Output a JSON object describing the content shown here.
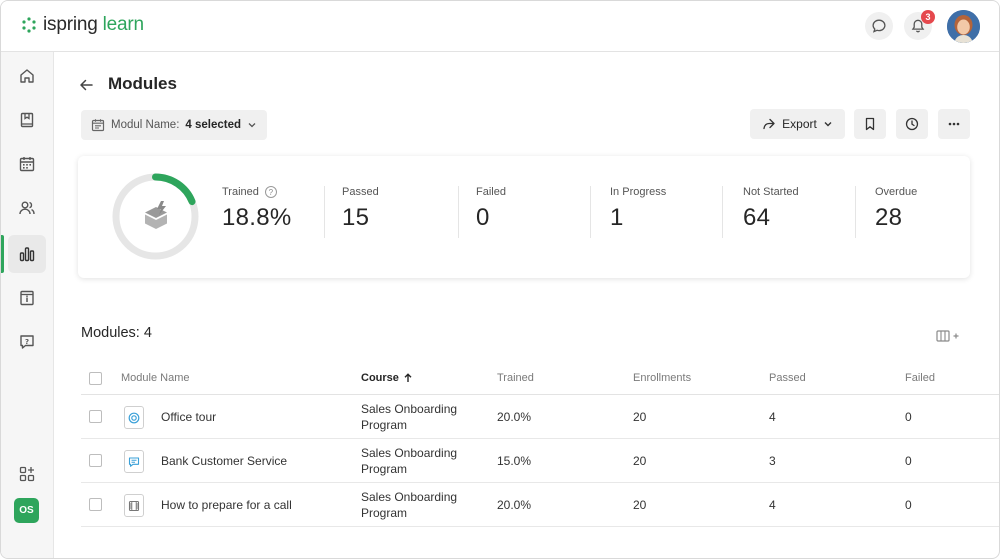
{
  "app": {
    "logo_part1": "ispring",
    "logo_part2": " learn"
  },
  "header": {
    "notification_count": "3"
  },
  "sidebar": {
    "items": [
      {
        "icon": "home-icon"
      },
      {
        "icon": "book-icon"
      },
      {
        "icon": "calendar-icon"
      },
      {
        "icon": "users-icon"
      },
      {
        "icon": "reports-icon"
      },
      {
        "icon": "info-icon"
      },
      {
        "icon": "help-icon"
      },
      {
        "icon": "add-apps-icon"
      }
    ],
    "user_initials": "OS"
  },
  "page": {
    "title": "Modules",
    "filter_label": "Modul Name:",
    "filter_value": "4 selected",
    "export_label": "Export"
  },
  "stats": {
    "trained_fraction": 0.188,
    "items": [
      {
        "label": "Trained",
        "value": "18.8%"
      },
      {
        "label": "Passed",
        "value": "15"
      },
      {
        "label": "Failed",
        "value": "0"
      },
      {
        "label": "In Progress",
        "value": "1"
      },
      {
        "label": "Not Started",
        "value": "64"
      },
      {
        "label": "Overdue",
        "value": "28"
      }
    ]
  },
  "table": {
    "title": "Modules: 4",
    "columns": [
      "Module Name",
      "Course",
      "Trained",
      "Enrollments",
      "Passed",
      "Failed"
    ],
    "rows": [
      {
        "name": "Office tour",
        "course_line1": "Sales Onboarding",
        "course_line2": "Program",
        "trained": "20.0%",
        "enrollments": "20",
        "passed": "4",
        "failed": "0",
        "icon": "target-icon"
      },
      {
        "name": "Bank Customer Service",
        "course_line1": "Sales Onboarding",
        "course_line2": "Program",
        "trained": "15.0%",
        "enrollments": "20",
        "passed": "3",
        "failed": "0",
        "icon": "chat-icon"
      },
      {
        "name": "How to prepare for a call",
        "course_line1": "Sales Onboarding",
        "course_line2": "Program",
        "trained": "20.0%",
        "enrollments": "20",
        "passed": "4",
        "failed": "0",
        "icon": "video-icon"
      }
    ]
  },
  "colors": {
    "accent": "#2ea55c",
    "badge": "#e5484d"
  }
}
